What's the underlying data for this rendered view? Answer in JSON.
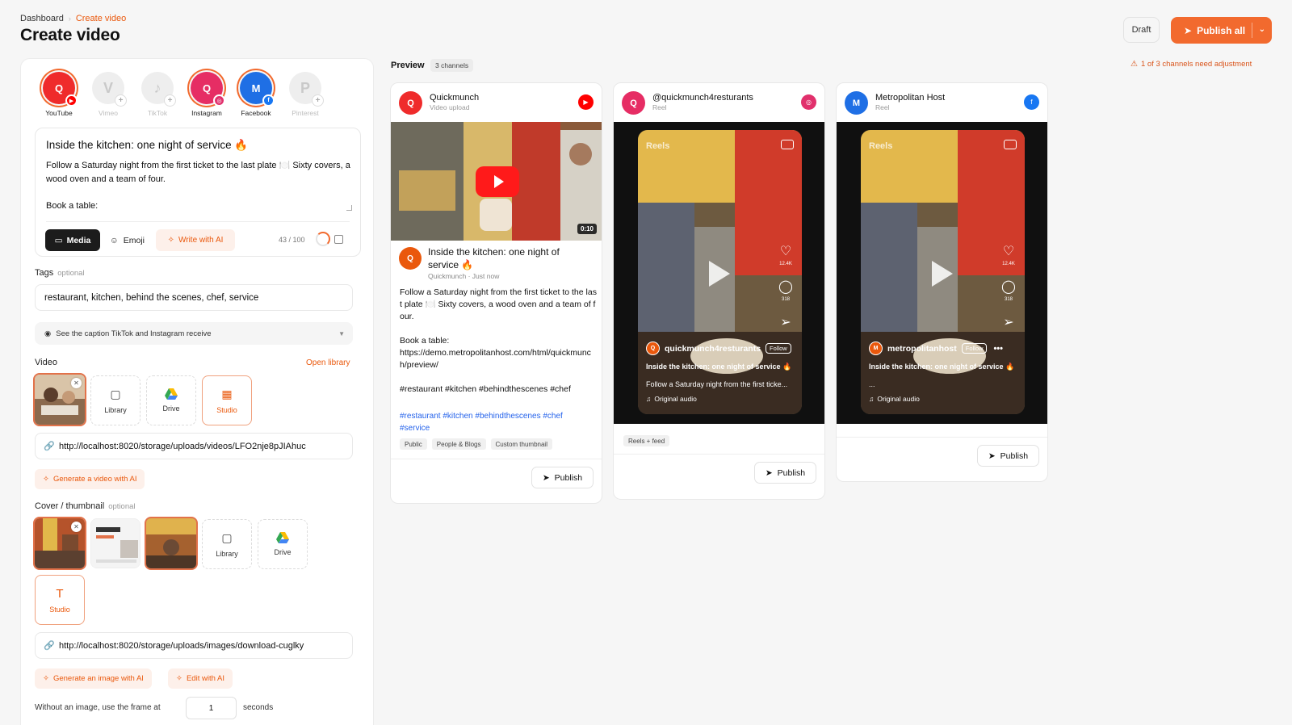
{
  "breadcrumb": {
    "root": "Dashboard",
    "current": "Create video"
  },
  "page_title": "Create video",
  "header": {
    "draft_label": "Draft",
    "publish_all_label": "Publish all"
  },
  "channels": [
    {
      "label": "YouTube",
      "initial": "Q",
      "active": true
    },
    {
      "label": "Vimeo",
      "initial": "V",
      "active": false
    },
    {
      "label": "TikTok",
      "initial": "♪",
      "active": false
    },
    {
      "label": "Instagram",
      "initial": "Q",
      "active": true
    },
    {
      "label": "Facebook",
      "initial": "M",
      "active": true
    },
    {
      "label": "Pinterest",
      "initial": "P",
      "active": false
    }
  ],
  "caption": {
    "title": "Inside the kitchen: one night of service 🔥",
    "body": "Follow a Saturday night from the first ticket to the last plate 🍽️ Sixty covers, a wood oven and a team of four.",
    "book": "Book a table:",
    "media_label": "Media",
    "emoji_label": "Emoji",
    "ai_label": "Write with AI",
    "char_count": "43 / 100"
  },
  "tags": {
    "label": "Tags",
    "optional": "optional",
    "value": "restaurant, kitchen, behind the scenes, chef, service"
  },
  "see_caption_label": "See the caption TikTok and Instagram receive",
  "video": {
    "label": "Video",
    "open_library": "Open library",
    "tiles": {
      "library": "Library",
      "drive": "Drive",
      "studio": "Studio"
    },
    "url": "http://localhost:8020/storage/uploads/videos/LFO2nje8pJIAhuc",
    "generate_label": "Generate a video with AI"
  },
  "cover": {
    "label": "Cover / thumbnail",
    "optional": "optional",
    "tiles": {
      "library": "Library",
      "drive": "Drive",
      "studio": "Studio"
    },
    "url": "http://localhost:8020/storage/uploads/images/download-cuglky",
    "generate_label": "Generate an image with AI",
    "edit_label": "Edit with AI",
    "frame_text": "Without an image, use the frame at",
    "frame_value": "1",
    "seconds": "seconds"
  },
  "preview": {
    "label": "Preview",
    "channel_count": "3 channels",
    "warning": "1 of 3 channels need adjustment"
  },
  "cards": {
    "youtube": {
      "name": "Quickmunch",
      "sub": "Video upload",
      "initial": "Q",
      "duration": "0:10",
      "title": "Inside the kitchen: one night of service 🔥",
      "meta": "Quickmunch · Just now",
      "desc": "Follow a Saturday night from the first ticket to the last plate 🍽️ Sixty covers, a wood oven and a team of four.\n\nBook a table:\nhttps://demo.metropolitanhost.com/html/quickmunch/preview/\n\n#restaurant #kitchen #behindthescenes #chef",
      "hashtags": "#restaurant #kitchen #behindthescenes #chef #service",
      "chips": [
        "Public",
        "People & Blogs",
        "Custom thumbnail"
      ],
      "publish": "Publish"
    },
    "instagram": {
      "name": "@quickmunch4resturants",
      "sub": "Reel",
      "initial": "Q",
      "reels_label": "Reels",
      "likes": "12.4K",
      "comments": "318",
      "user": "quickmunch4resturants",
      "follow": "Follow",
      "title": "Inside the kitchen: one night of service 🔥",
      "desc": "Follow a Saturday night from the first ticke...",
      "audio": "Original audio",
      "tag": "Reels + feed",
      "publish": "Publish"
    },
    "facebook": {
      "name": "Metropolitan Host",
      "sub": "Reel",
      "initial": "M",
      "reels_label": "Reels",
      "likes": "12.4K",
      "comments": "318",
      "user": "metropolitanhost",
      "follow": "Follow",
      "title": "Inside the kitchen: one night of service 🔥",
      "desc": "...",
      "audio": "Original audio",
      "publish": "Publish"
    }
  },
  "colors": {
    "accent": "#f26a2e",
    "youtube": "#ff0000",
    "instagram": "#e1306c",
    "facebook": "#1877f2"
  }
}
